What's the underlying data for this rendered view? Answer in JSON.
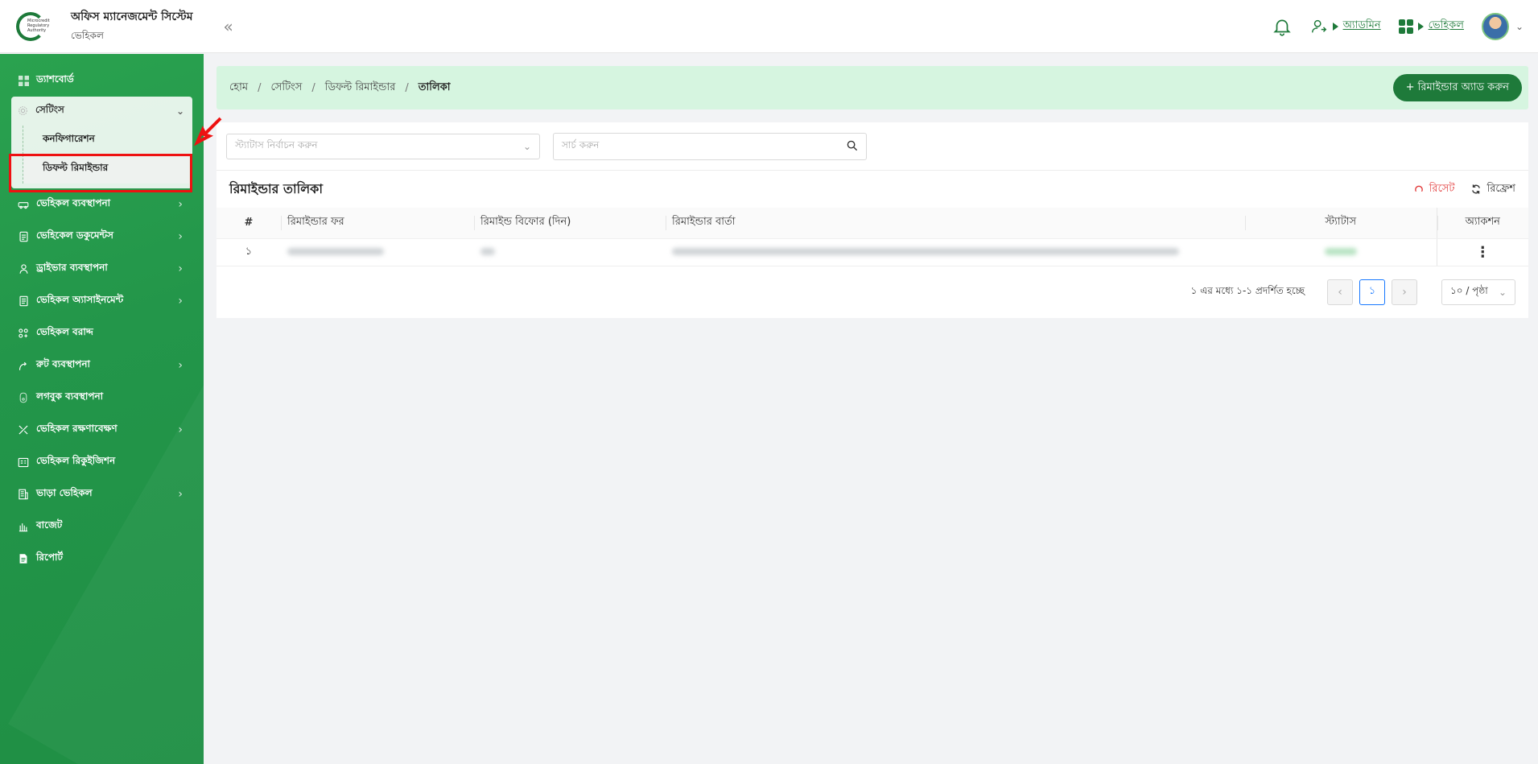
{
  "header": {
    "logo_text": "Microcredit Regulatory Authority",
    "title": "অফিস ম্যানেজমেন্ট সিস্টেম",
    "subtitle": "ভেহিকল",
    "collapse_glyph": "«",
    "role_label": "অ্যাডমিন",
    "module_label": "ভেহিকল",
    "avatar_caret": "⌄",
    "accent": "#1e7a3a"
  },
  "sidebar": {
    "items": [
      {
        "label": "ড্যাশবোর্ড",
        "icon": "dashboard-icon"
      },
      {
        "label": "ভেহিকল ব্যবস্থাপনা",
        "icon": "car-icon"
      },
      {
        "label": "ভেহিকেল ডকুমেন্টস",
        "icon": "document-icon"
      },
      {
        "label": "ড্রাইভার ব্যবস্থাপনা",
        "icon": "driver-icon"
      },
      {
        "label": "ভেহিকল অ্যাসাইনমেন্ট",
        "icon": "assignment-icon"
      },
      {
        "label": "ভেহিকল বরাদ্দ",
        "icon": "allocation-icon"
      },
      {
        "label": "রুট ব্যবস্থাপনা",
        "icon": "route-icon"
      },
      {
        "label": "লগবুক ব্যবস্থাপনা",
        "icon": "logbook-icon"
      },
      {
        "label": "ভেহিকল রক্ষণাবেক্ষণ",
        "icon": "maintenance-icon"
      },
      {
        "label": "ভেহিকল রিকুইজিশন",
        "icon": "requisition-icon"
      },
      {
        "label": "ভাড়া ভেহিকল",
        "icon": "rent-icon"
      },
      {
        "label": "বাজেট",
        "icon": "budget-icon"
      },
      {
        "label": "রিপোর্ট",
        "icon": "report-icon"
      }
    ],
    "settings": {
      "label": "সেটিংস",
      "children": [
        "কনফিগারেশন",
        "ডিফল্ট রিমাইন্ডার"
      ]
    }
  },
  "breadcrumb": [
    "হোম",
    "সেটিংস",
    "ডিফল্ট রিমাইন্ডার",
    "তালিকা"
  ],
  "breadcrumb_sep": "/",
  "toolbar": {
    "add_label": "+ রিমাইন্ডার অ্যাড করুন"
  },
  "filters": {
    "status_placeholder": "স্ট্যাটাস নির্বাচন করুন",
    "search_placeholder": "সার্চ করুন"
  },
  "table": {
    "title": "রিমাইন্ডার তালিকা",
    "reset_label": "রিসেট",
    "refresh_label": "রিফ্রেশ",
    "columns": [
      "#",
      "রিমাইন্ডার ফর",
      "রিমাইন্ড বিফোর (দিন)",
      "রিমাইন্ডার বার্তা",
      "স্ট্যাটাস",
      "অ্যাকশন"
    ],
    "rows": [
      {
        "index": "১",
        "action_glyph": "⋮"
      }
    ]
  },
  "pagination": {
    "info": "১ এর মধ্যে ১-১ প্রদর্শিত হচ্ছে",
    "prev": "‹",
    "current": "১",
    "next": "›",
    "per_page": "১০ / পৃষ্ঠা"
  }
}
